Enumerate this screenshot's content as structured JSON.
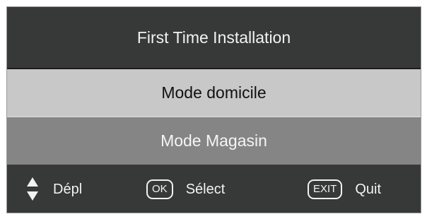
{
  "title": "First Time Installation",
  "menu": {
    "items": [
      {
        "label": "Mode domicile",
        "state": "highlighted"
      },
      {
        "label": "Mode Magasin",
        "state": "normal"
      }
    ]
  },
  "footer": {
    "move": {
      "icon": "up-down-arrows-icon",
      "label": "Dépl"
    },
    "select": {
      "key": "OK",
      "label": "Sélect"
    },
    "quit": {
      "key": "EXIT",
      "label": "Quit"
    }
  },
  "colors": {
    "panel": "#363937",
    "highlight": "#c8c8c8",
    "item": "#858585",
    "text_light": "#f2f2f2"
  }
}
